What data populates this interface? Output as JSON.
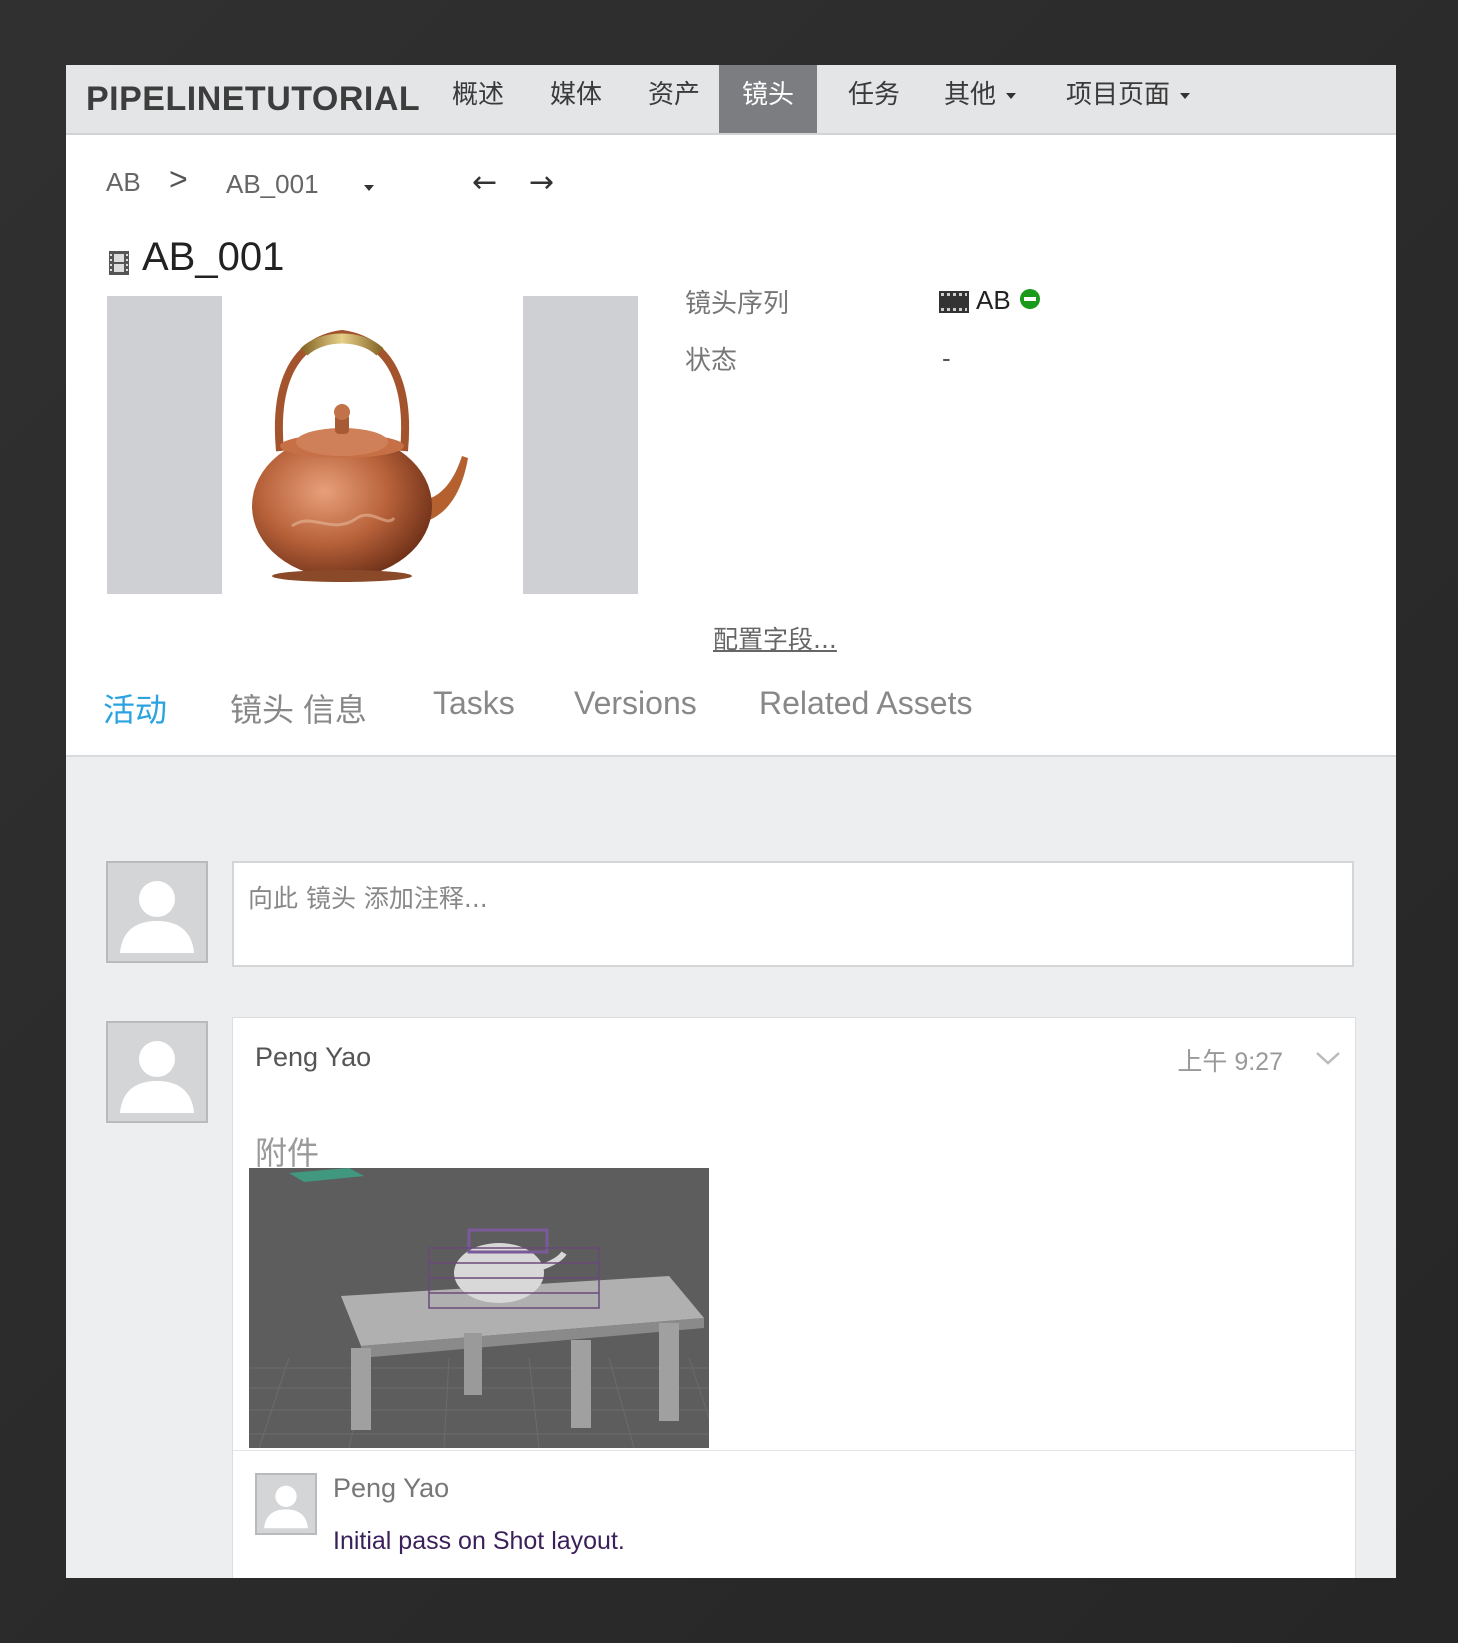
{
  "nav": {
    "brand": "PIPELINETUTORIAL",
    "items": [
      {
        "label": "概述"
      },
      {
        "label": "媒体"
      },
      {
        "label": "资产"
      },
      {
        "label": "镜头"
      },
      {
        "label": "任务"
      },
      {
        "label": "其他"
      },
      {
        "label": "项目页面"
      }
    ],
    "active_item": "镜头"
  },
  "breadcrumb": {
    "parent": "AB",
    "separator": ">",
    "current": "AB_001"
  },
  "page_title": "AB_001",
  "fields": {
    "sequence_label": "镜头序列",
    "sequence_value": "AB",
    "status_label": "状态",
    "status_value": "-",
    "config_link": "配置字段..."
  },
  "tabs": [
    {
      "label": "活动"
    },
    {
      "label": "镜头 信息"
    },
    {
      "label": "Tasks"
    },
    {
      "label": "Versions"
    },
    {
      "label": "Related Assets"
    }
  ],
  "active_tab": "活动",
  "note_input": {
    "placeholder": "向此 镜头 添加注释..."
  },
  "activity": {
    "author": "Peng Yao",
    "time": "上午 9:27",
    "attachments_label": "附件",
    "reply": {
      "author": "Peng Yao",
      "text": "Initial pass on Shot layout."
    }
  },
  "colors": {
    "accent": "#2aa3e0",
    "nav_active_bg": "#7b7d80",
    "status_green": "#1a9a1a"
  }
}
